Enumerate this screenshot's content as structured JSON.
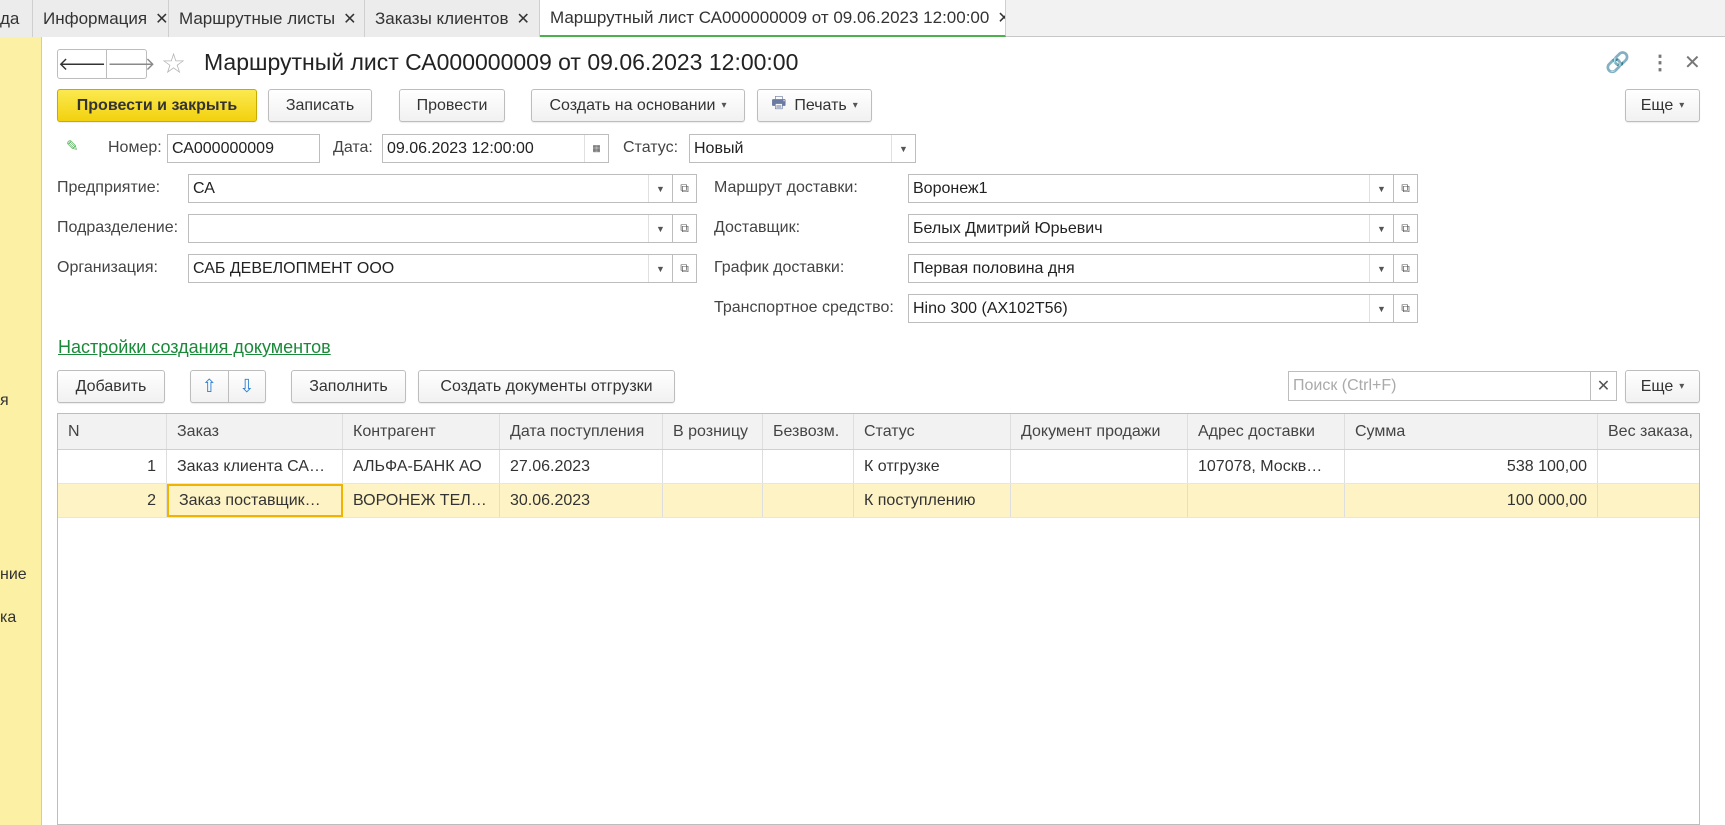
{
  "tabs": [
    {
      "label": "да",
      "closable": false
    },
    {
      "label": "Информация",
      "closable": true
    },
    {
      "label": "Маршрутные листы",
      "closable": true
    },
    {
      "label": "Заказы клиентов",
      "closable": true
    },
    {
      "label": "Маршрутный лист СА000000009 от 09.06.2023 12:00:00",
      "closable": true,
      "active": true
    }
  ],
  "left_panel": {
    "items": [
      "я",
      "ние",
      "ка"
    ]
  },
  "header": {
    "back_icon": "arrow-left-icon",
    "forward_icon": "arrow-right-icon",
    "title": "Маршрутный лист СА000000009 от 09.06.2023 12:00:00"
  },
  "toolbar": {
    "post_close": "Провести и закрыть",
    "save": "Записать",
    "post": "Провести",
    "create_based": "Создать на основании",
    "print": "Печать",
    "more": "Еще"
  },
  "form": {
    "number_label": "Номер:",
    "number_value": "СА000000009",
    "date_label": "Дата:",
    "date_value": "09.06.2023 12:00:00",
    "status_label": "Статус:",
    "status_value": "Новый",
    "enterprise_label": "Предприятие:",
    "enterprise_value": "СА",
    "department_label": "Подразделение:",
    "department_value": "",
    "organization_label": "Организация:",
    "organization_value": "САБ ДЕВЕЛОПМЕНТ ООО",
    "route_label": "Маршрут доставки:",
    "route_value": "Воронеж1",
    "carrier_label": "Доставщик:",
    "carrier_value": "Белых Дмитрий Юрьевич",
    "schedule_label": "График доставки:",
    "schedule_value": "Первая половина дня",
    "vehicle_label": "Транспортное средство:",
    "vehicle_value": "Hino 300 (АХ102Т56)"
  },
  "settings_link": "Настройки создания документов",
  "table_toolbar": {
    "add": "Добавить",
    "fill": "Заполнить",
    "create_shipping": "Создать документы отгрузки",
    "search_placeholder": "Поиск (Ctrl+F)",
    "more": "Еще"
  },
  "table": {
    "columns": [
      "N",
      "Заказ",
      "Контрагент",
      "Дата поступления",
      "В розницу",
      "Безвозм.",
      "Статус",
      "Документ продажи",
      "Адрес доставки",
      "Сумма",
      "Вес заказа,"
    ],
    "rows": [
      [
        "1",
        "Заказ клиента СА…",
        "АЛЬФА-БАНК АО",
        "27.06.2023",
        "",
        "",
        "К отгрузке",
        "",
        "107078, Москв…",
        "538 100,00",
        ""
      ],
      [
        "2",
        "Заказ поставщик…",
        "ВОРОНЕЖ ТЕЛ…",
        "30.06.2023",
        "",
        "",
        "К поступлению",
        "",
        "",
        "100 000,00",
        ""
      ]
    ]
  },
  "colors": {
    "accent_yellow": "#f2d10e",
    "link_green": "#1a8a3a",
    "row_selected": "#fdf3c4"
  }
}
